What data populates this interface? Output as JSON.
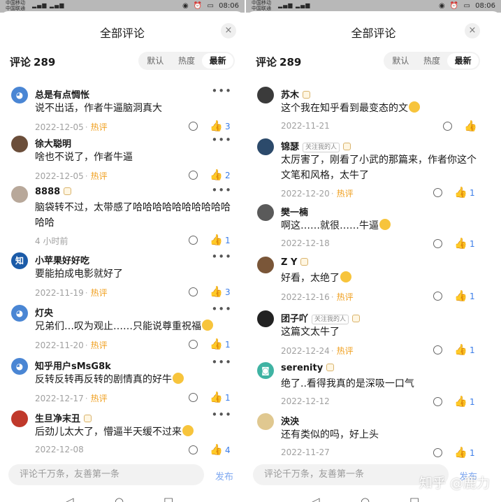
{
  "left": {
    "status": {
      "carrier1": "中国移动",
      "carrier2": "中国联通",
      "time": "08:06"
    },
    "title": "全部评论",
    "close": "×",
    "comment_label": "评论",
    "comment_count": "289",
    "tabs": [
      "默认",
      "热度",
      "最新"
    ],
    "comments": [
      {
        "author": "总是有点惆怅",
        "text": "说不出话，作者牛逼脑洞真大",
        "date": "2022-12-05",
        "hot": "热评",
        "likes": "3"
      },
      {
        "author": "徐大聪明",
        "text": "啥也不说了，作者牛逼",
        "date": "2022-12-05",
        "hot": "热评",
        "likes": "2"
      },
      {
        "author": "8888",
        "text": "脑袋转不过，太带感了哈哈哈哈哈哈哈哈哈哈哈哈",
        "date": "4 小时前",
        "hot": "",
        "likes": "1"
      },
      {
        "author": "小苹果好好吃",
        "text": "要能拍成电影就好了",
        "date": "2022-11-19",
        "hot": "热评",
        "likes": "3"
      },
      {
        "author": "灯央",
        "text": "兄弟们…叹为观止……只能说尊重祝福",
        "date": "2022-11-20",
        "hot": "热评",
        "likes": "1"
      },
      {
        "author": "知乎用户sMsG8k",
        "text": "反转反转再反转的剧情真的好牛",
        "date": "2022-12-17",
        "hot": "热评",
        "likes": "1"
      },
      {
        "author": "生旦净末丑",
        "text": "后劲儿太大了，懵逼半天缓不过来",
        "date": "2022-12-08",
        "hot": "",
        "likes": "4"
      }
    ],
    "input_placeholder": "评论千万条，友善第一条",
    "publish": "发布"
  },
  "right": {
    "title": "全部评论",
    "close": "×",
    "comment_label": "评论",
    "comment_count": "289",
    "tabs": [
      "默认",
      "热度",
      "最新"
    ],
    "comments": [
      {
        "author": "苏木",
        "text": "这个我在知乎看到最变态的文",
        "date": "2022-11-21",
        "hot": "",
        "likes": ""
      },
      {
        "author": "锦瑟",
        "follow": "关注我的人",
        "text": "太厉害了，刚看了小武的那篇来，作者你这个文笔和风格，太牛了",
        "date": "2022-12-20",
        "hot": "热评",
        "likes": "1"
      },
      {
        "author": "樊一楠",
        "text": "啊这……就很……牛逼",
        "date": "2022-12-18",
        "hot": "",
        "likes": "1"
      },
      {
        "author": "Z Y",
        "text": "好看，太绝了",
        "date": "2022-12-16",
        "hot": "热评",
        "likes": "1"
      },
      {
        "author": "团子吖",
        "follow": "关注我的人",
        "text": "这篇文太牛了",
        "date": "2022-12-24",
        "hot": "热评",
        "likes": "1"
      },
      {
        "author": "serenity",
        "text": "绝了..看得我真的是深吸一口气",
        "date": "2022-12-12",
        "hot": "",
        "likes": "1"
      },
      {
        "author": "泱泱",
        "text": "还有类似的吗，好上头",
        "date": "2022-11-27",
        "hot": "",
        "likes": "1"
      }
    ],
    "input_placeholder": "评论千万条，友善第一条",
    "publish": "发布"
  },
  "nav": {
    "back": "◁",
    "home": "○",
    "recent": "□"
  },
  "watermark": "知乎 @鹿力",
  "colors": {
    "accent": "#3b7de8",
    "hot": "#f0a020",
    "muted": "#a0a0a0"
  }
}
